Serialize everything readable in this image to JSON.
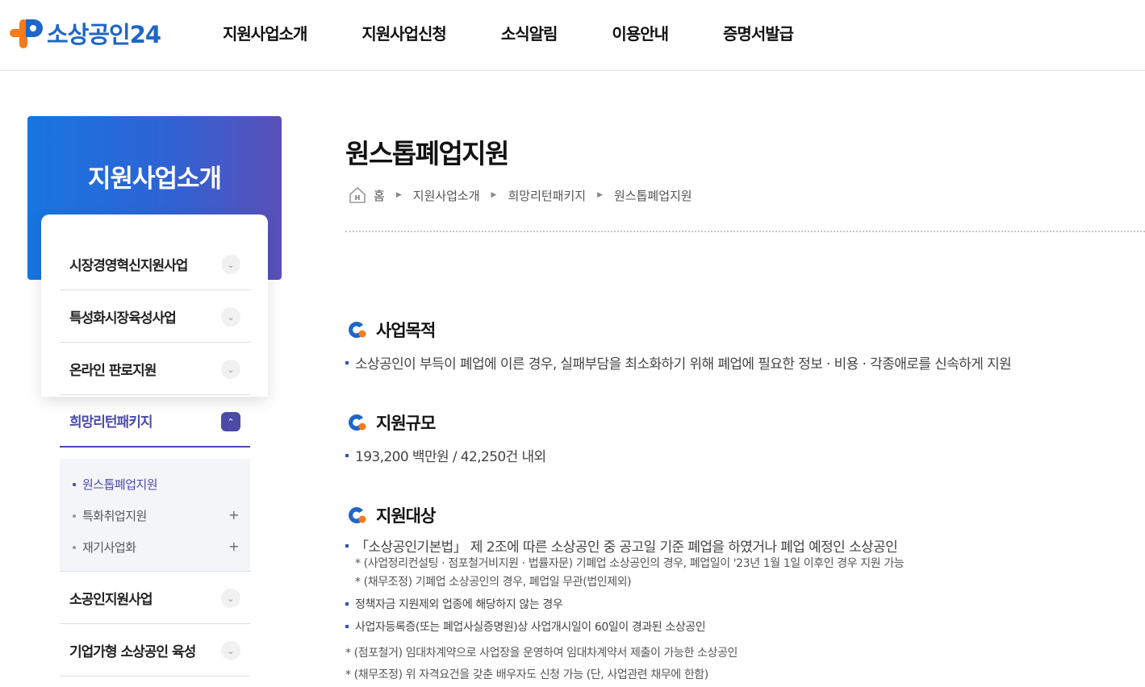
{
  "header": {
    "logo_text": "소상공인24",
    "nav": [
      "지원사업소개",
      "지원사업신청",
      "소식알림",
      "이용안내",
      "증명서발급"
    ]
  },
  "sidebar": {
    "banner_title": "지원사업소개",
    "menu": [
      {
        "label": "시장경영혁신지원사업"
      },
      {
        "label": "특성화시장육성사업"
      },
      {
        "label": "온라인 판로지원"
      },
      {
        "label": "희망리턴패키지"
      },
      {
        "label": "소공인지원사업"
      },
      {
        "label": "기업가형 소상공인 육성"
      }
    ],
    "submenu": [
      {
        "label": "원스톱폐업지원"
      },
      {
        "label": "특화취업지원",
        "expander": "+"
      },
      {
        "label": "재기사업화",
        "expander": "+"
      }
    ]
  },
  "main": {
    "title": "원스톱폐업지원",
    "breadcrumb": [
      "홈",
      "지원사업소개",
      "희망리턴패키지",
      "원스톱폐업지원"
    ],
    "sections": [
      {
        "title": "사업목적",
        "lines": [
          "소상공인이 부득이 폐업에 이른 경우, 실패부담을 최소화하기 위해 폐업에 필요한 정보 · 비용 · 각종애로를 신속하게 지원"
        ]
      },
      {
        "title": "지원규모",
        "lines": [
          "193,200 백만원 / 42,250건 내외"
        ]
      },
      {
        "title": "지원대상",
        "main_line": "「소상공인기본법」 제 2조에 따른 소상공인 중 공고일 기준 폐업을 하였거나 폐업 예정인 소상공인",
        "sub_notes": [
          "* (사업정리컨설팅 · 점포철거비지원 · 법률자문) 기폐업 소상공인의 경우, 폐업일이 '23년 1월 1일 이후인 경우 지원 가능",
          "* (채무조정) 기폐업 소상공인의 경우, 폐업일 무관(법인제외)"
        ],
        "lines": [
          "정책자금 지원제외 업종에 해당하지 않는 경우",
          "사업자등록증(또는 폐업사실증명원)상 사업개시일이 60일이 경과된 소상공인"
        ],
        "notes": [
          "* (점포철거) 임대차계약으로 사업장을 운영하여 임대차계약서 제출이 가능한 소상공인",
          "* (채무조정) 위 자격요건을 갖춘 배우자도 신청 가능 (단, 사업관련 채무에 한함)"
        ]
      }
    ]
  },
  "colors": {
    "brand_blue": "#1f66c8",
    "brand_orange": "#f47b20",
    "active_purple": "#4b4aa8"
  },
  "icons": {
    "logo": "plus-p-logo-icon",
    "chevron": "chevron-down-icon",
    "chevron_up": "chevron-up-icon",
    "home": "home-icon",
    "section": "section-bullet-icon"
  }
}
